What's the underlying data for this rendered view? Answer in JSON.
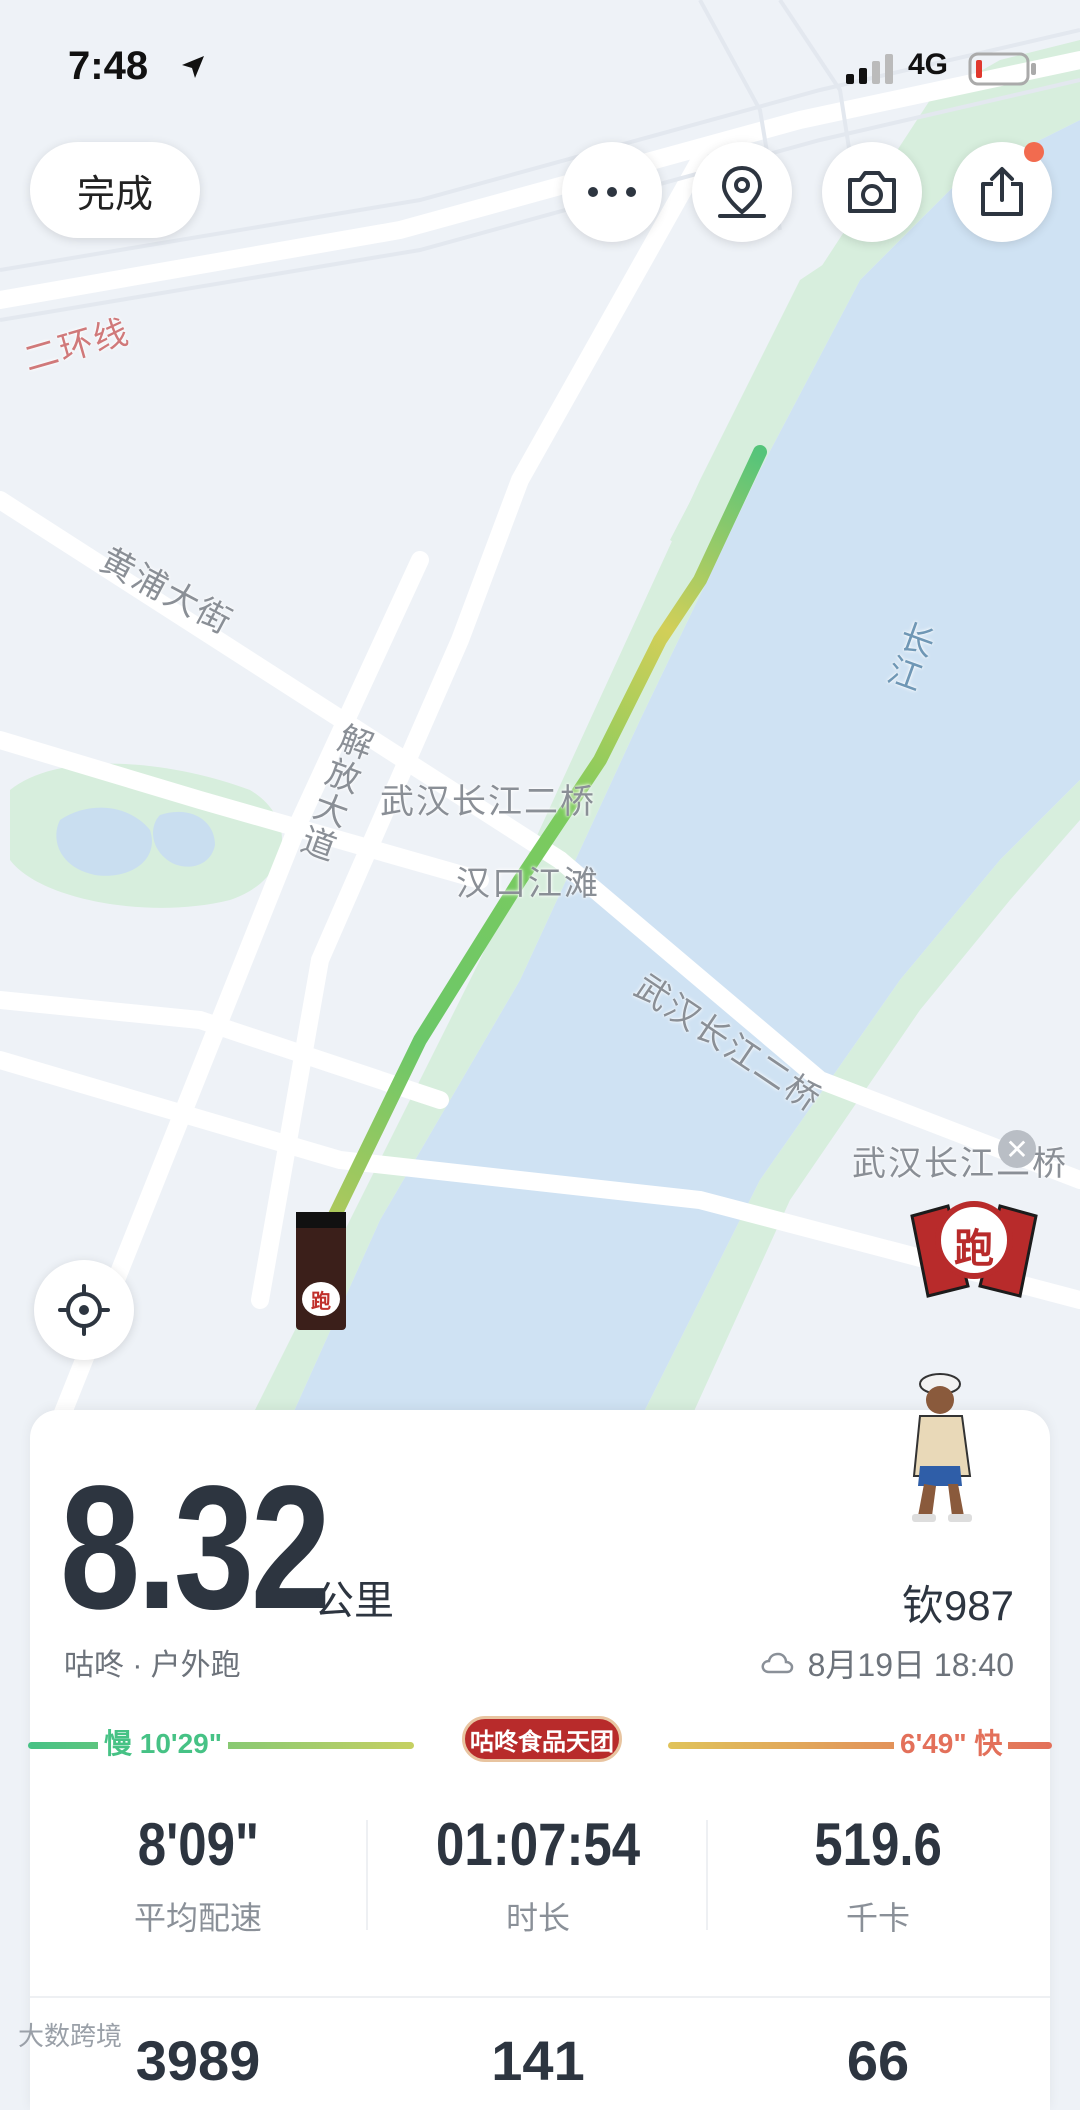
{
  "status_bar": {
    "time": "7:48",
    "network": "4G"
  },
  "header": {
    "done_label": "完成"
  },
  "icons": {
    "more": "more-icon",
    "route_pin": "location-pin-icon",
    "camera": "camera-icon",
    "share": "share-icon",
    "locate": "crosshair-icon"
  },
  "map": {
    "labels": {
      "ring_line": "二环线",
      "huangpu": "黄浦大街",
      "jiefang": "解放大道",
      "bridge_a": "武汉长江二桥",
      "hankou": "汉口江滩",
      "bridge_b": "武汉长江二桥",
      "bridge_c": "武汉长江二桥",
      "river": "长江"
    },
    "sticker_text": "跑",
    "runner_glyph": "跑",
    "colors": {
      "water": "#cfe2f3",
      "park": "#d7eedd",
      "route_start": "#4cc77f",
      "route_mid": "#c8d35a"
    }
  },
  "summary": {
    "distance": "8.32",
    "unit": "公里",
    "subtitle": "咕咚 · 户外跑",
    "username": "钦987",
    "datetime": "8月19日 18:40"
  },
  "pace_bar": {
    "slow_label": "慢 10'29\"",
    "fast_label": "6'49\" 快",
    "brand": "咕咚食品天团",
    "colors": {
      "slow": "#46c285",
      "mid": "#c6d062",
      "fast": "#e3705a"
    }
  },
  "stats": [
    {
      "value": "8'09\"",
      "label": "平均配速"
    },
    {
      "value": "01:07:54",
      "label": "时长"
    },
    {
      "value": "519.6",
      "label": "千卡"
    }
  ],
  "next_row": {
    "values": [
      "3989",
      "141",
      "66"
    ]
  },
  "watermark": "大数跨境"
}
